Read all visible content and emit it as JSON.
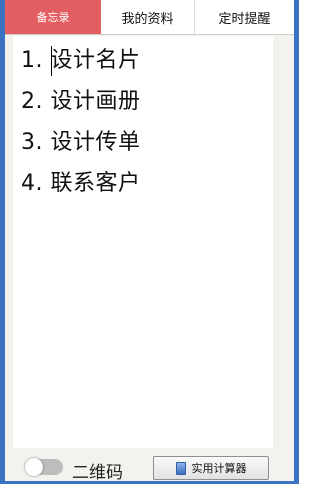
{
  "tabs": [
    {
      "label": "备忘录",
      "active": true
    },
    {
      "label": "我的资料",
      "active": false
    },
    {
      "label": "定时提醒",
      "active": false
    }
  ],
  "note": {
    "lines": [
      "1. 设计名片",
      "2. 设计画册",
      "3. 设计传单",
      "4. 联系客户"
    ]
  },
  "footer": {
    "qr_label": "二维码",
    "qr_toggle_on": false,
    "calculator_label": "实用计算器"
  },
  "colors": {
    "active_tab": "#e35e62",
    "window_border": "#3b73c2",
    "panel_background": "#f3f2ee"
  }
}
